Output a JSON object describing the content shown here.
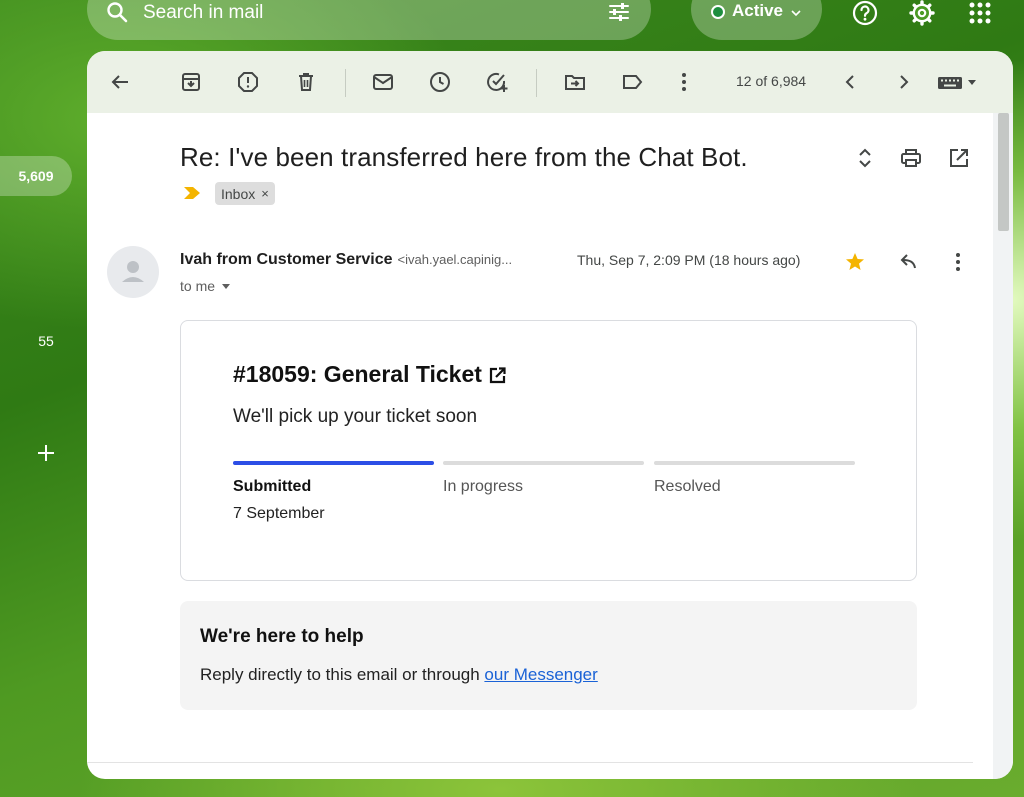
{
  "colors": {
    "star": "#f4b400",
    "status_active": "#1e8e3e",
    "progress_active": "#2c4ee6",
    "link": "#1a62d6"
  },
  "search": {
    "placeholder": "Search in mail",
    "icon": "search-icon",
    "filter_icon": "tune-icon"
  },
  "status": {
    "label": "Active",
    "icon": "chevron-down-icon"
  },
  "top_icons": [
    "help-icon",
    "settings-icon",
    "apps-grid-icon"
  ],
  "rail": {
    "inbox_count": "5,609",
    "second_count": "55",
    "add_icon": "plus-icon"
  },
  "toolbar": {
    "icons": [
      "back-arrow-icon",
      "archive-icon",
      "report-spam-icon",
      "delete-icon",
      "mark-unread-icon",
      "snooze-icon",
      "add-task-icon",
      "move-to-icon",
      "label-icon",
      "more-vert-icon",
      "chevron-left-icon",
      "chevron-right-icon",
      "keyboard-icon"
    ],
    "pager": "12 of 6,984"
  },
  "email": {
    "subject": "Re: I've been transferred here from the Chat Bot.",
    "label": "Inbox",
    "label_close": "×",
    "sender_name": "Ivah from Customer Service",
    "sender_email": "<ivah.yael.capinig...",
    "date": "Thu, Sep 7, 2:09 PM (18 hours ago)",
    "to": "to me",
    "starred": true
  },
  "ticket": {
    "title": "#18059: General Ticket",
    "subtitle": "We'll pick up your ticket soon",
    "steps": [
      {
        "name": "Submitted",
        "date": "7 September",
        "active": true
      },
      {
        "name": "In progress",
        "date": "",
        "active": false
      },
      {
        "name": "Resolved",
        "date": "",
        "active": false
      }
    ]
  },
  "help": {
    "title": "We're here to help",
    "text": "Reply directly to this email or through ",
    "link_text": "our Messenger"
  }
}
